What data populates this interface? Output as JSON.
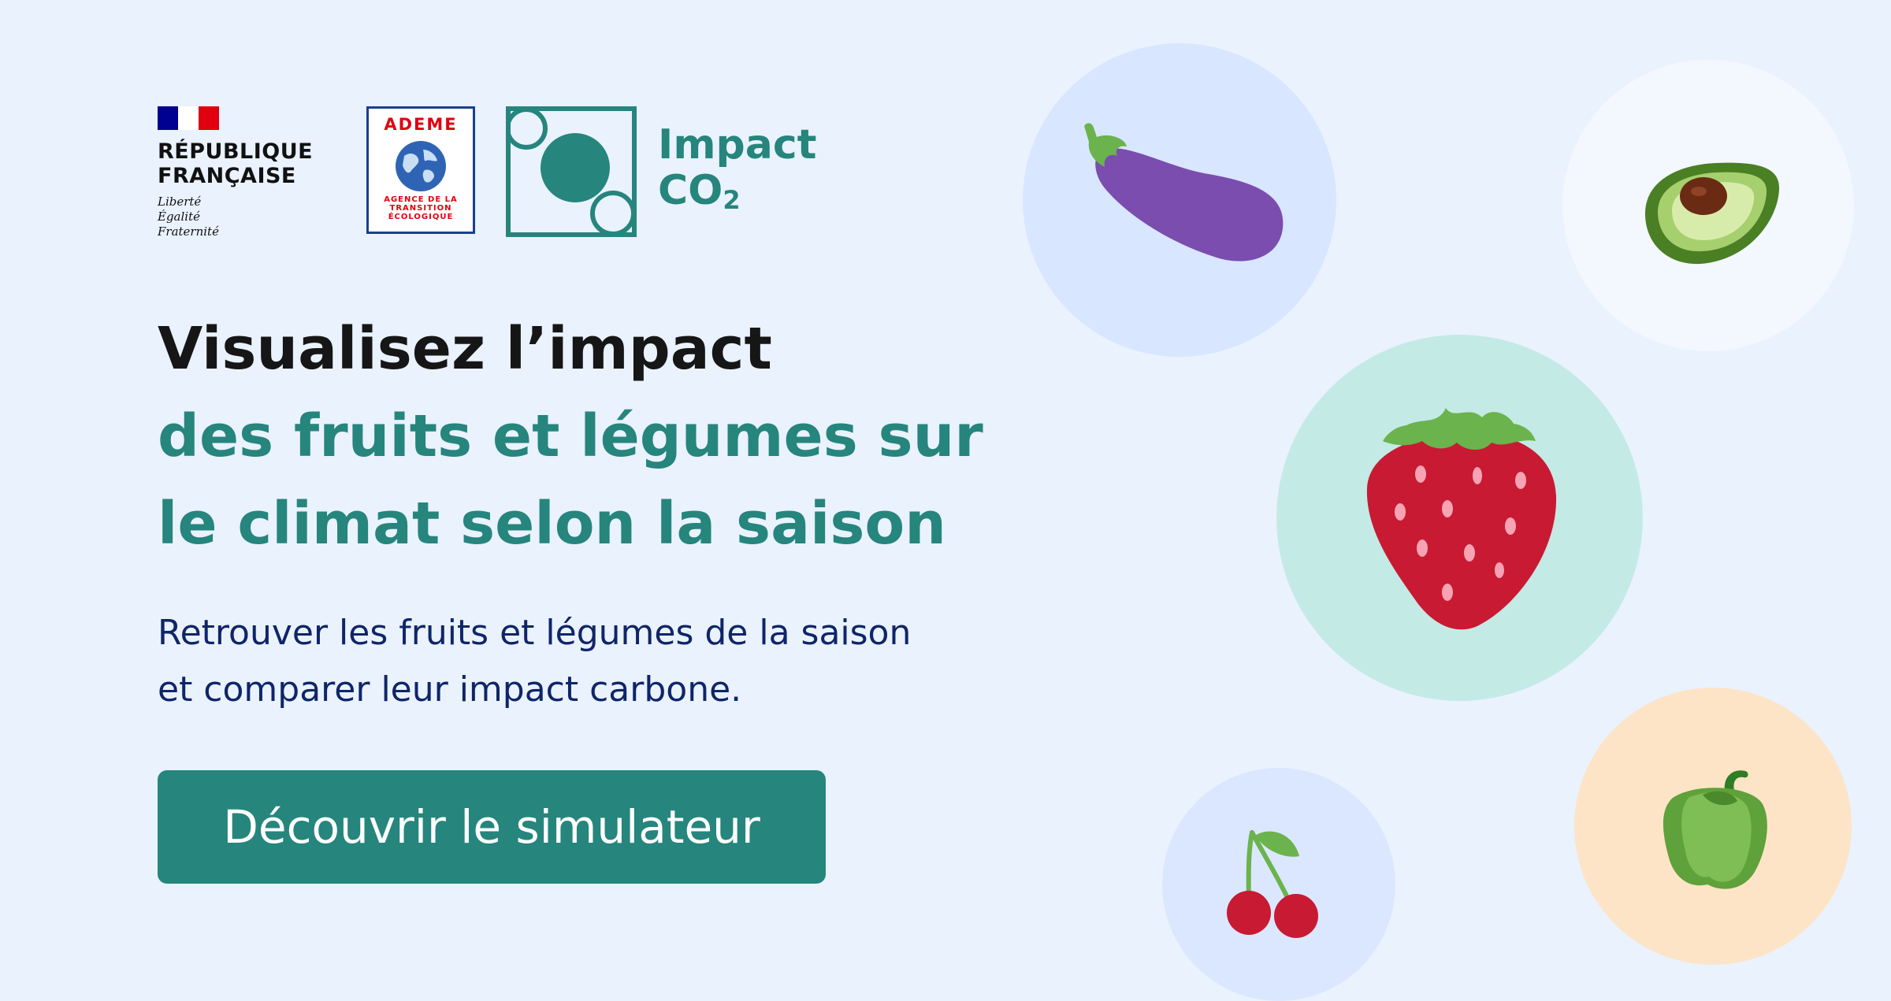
{
  "logos": {
    "republique": {
      "name_line1": "RÉPUBLIQUE",
      "name_line2": "FRANÇAISE",
      "motto_1": "Liberté",
      "motto_2": "Égalité",
      "motto_3": "Fraternité"
    },
    "ademe": {
      "title": "ADEME",
      "subtitle": "AGENCE DE LA\nTRANSITION\nÉCOLOGIQUE"
    },
    "impact_co2": {
      "line1": "Impact",
      "line2": "CO",
      "line2_sub": "2"
    }
  },
  "headline": {
    "line1": "Visualisez l’impact",
    "line2": "des fruits et légumes sur",
    "line3": "le climat selon la saison"
  },
  "subtext": {
    "line1": "Retrouver les fruits et légumes de la saison",
    "line2": "et comparer leur impact carbone."
  },
  "cta": {
    "label": "Découvrir le simulateur"
  },
  "illustrations": [
    {
      "name": "eggplant-icon"
    },
    {
      "name": "avocado-icon"
    },
    {
      "name": "strawberry-icon"
    },
    {
      "name": "cherry-icon"
    },
    {
      "name": "bell-pepper-icon"
    }
  ],
  "colors": {
    "background": "#eaf2fe",
    "accent": "#26857d",
    "heading": "#161616",
    "body_text": "#0f2569"
  }
}
